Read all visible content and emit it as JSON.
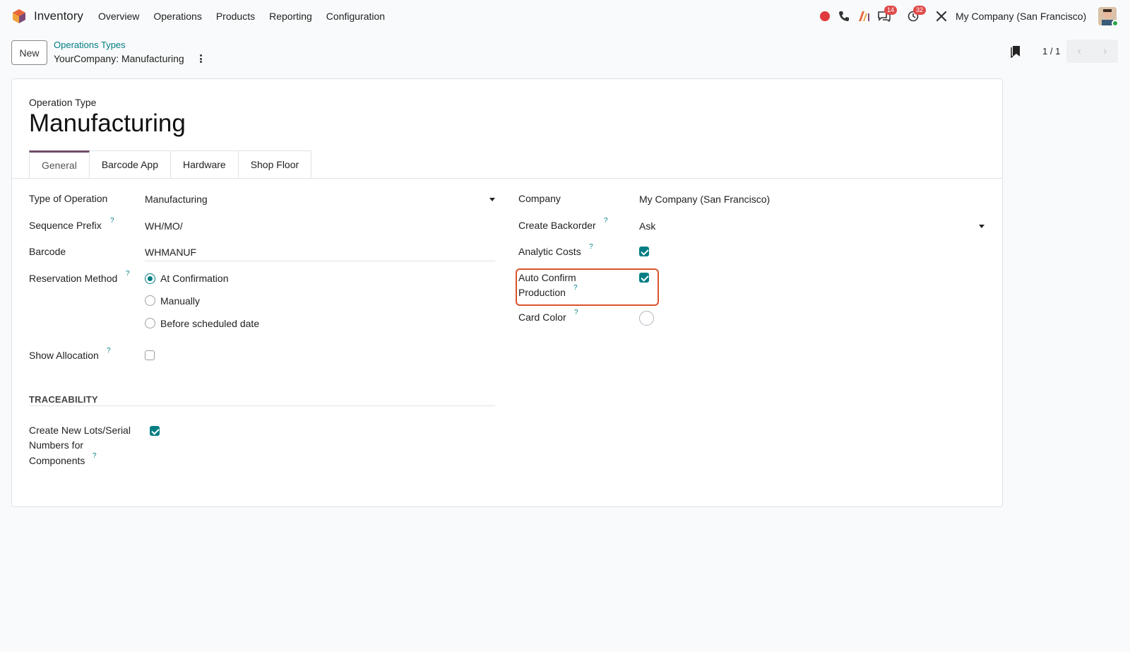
{
  "navbar": {
    "app_name": "Inventory",
    "menu": [
      "Overview",
      "Operations",
      "Products",
      "Reporting",
      "Configuration"
    ],
    "messages_badge": "14",
    "activities_badge": "32",
    "company": "My Company (San Francisco)"
  },
  "control_panel": {
    "new_label": "New",
    "breadcrumb_parent": "Operations Types",
    "breadcrumb_current": "YourCompany: Manufacturing",
    "pager": "1 / 1"
  },
  "form": {
    "op_label": "Operation Type",
    "title": "Manufacturing",
    "tabs": [
      "General",
      "Barcode App",
      "Hardware",
      "Shop Floor"
    ],
    "left": {
      "type_label": "Type of Operation",
      "type_value": "Manufacturing",
      "prefix_label": "Sequence Prefix",
      "prefix_value": "WH/MO/",
      "barcode_label": "Barcode",
      "barcode_value": "WHMANUF",
      "reservation_label": "Reservation Method",
      "reservation_options": [
        "At Confirmation",
        "Manually",
        "Before scheduled date"
      ],
      "show_alloc_label": "Show Allocation",
      "traceability_title": "TRACEABILITY",
      "lots_label_1": "Create New Lots/Serial",
      "lots_label_2": "Numbers for",
      "lots_label_3": "Components"
    },
    "right": {
      "company_label": "Company",
      "company_value": "My Company (San Francisco)",
      "backorder_label": "Create Backorder",
      "backorder_value": "Ask",
      "analytic_label": "Analytic Costs",
      "auto_confirm_label_1": "Auto Confirm",
      "auto_confirm_label_2": "Production",
      "card_color_label": "Card Color"
    },
    "help_mark": "?"
  },
  "colors": {
    "accent": "#017e84",
    "brand": "#714b67",
    "highlight": "#d9532c"
  }
}
